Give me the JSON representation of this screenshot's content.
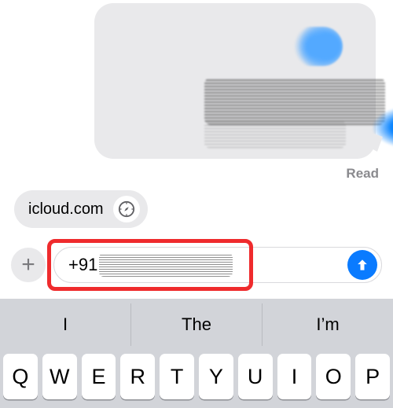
{
  "bubble_status": "Read",
  "link_preview": {
    "domain": "icloud.com"
  },
  "composer": {
    "plus_glyph": "+",
    "input_value": "+91",
    "send_label": "Send"
  },
  "keyboard": {
    "suggestions": [
      "I",
      "The",
      "I’m"
    ],
    "row1": [
      "Q",
      "W",
      "E",
      "R",
      "T",
      "Y",
      "U",
      "I",
      "O",
      "P"
    ]
  }
}
